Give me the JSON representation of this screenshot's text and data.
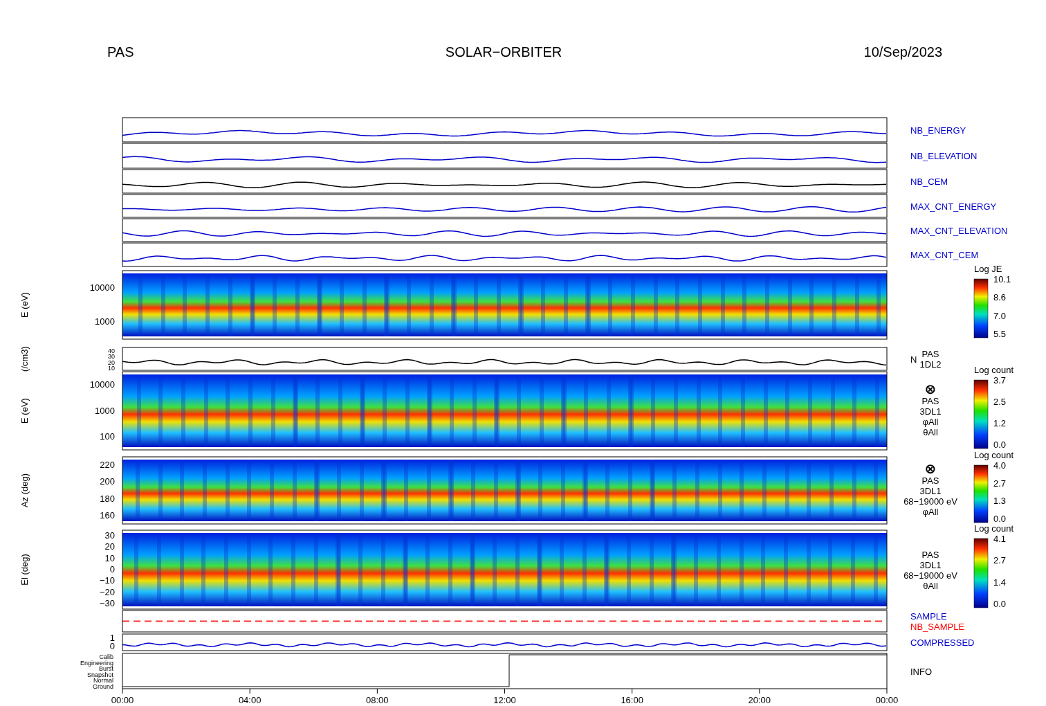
{
  "header": {
    "instrument": "PAS",
    "mission": "SOLAR−ORBITER",
    "date": "10/Sep/2023"
  },
  "panels": [
    {
      "kind": "line",
      "color": "#0000cc",
      "labels": [
        {
          "text": "NB_ENERGY",
          "color": "#0000cc"
        }
      ]
    },
    {
      "kind": "line",
      "color": "#0000cc",
      "labels": [
        {
          "text": "NB_ELEVATION",
          "color": "#0000cc"
        }
      ]
    },
    {
      "kind": "line",
      "color": "#000000",
      "labels": [
        {
          "text": "NB_CEM",
          "color": "#0000cc"
        }
      ]
    },
    {
      "kind": "line",
      "color": "#0000cc",
      "labels": [
        {
          "text": "MAX_CNT_ENERGY",
          "color": "#0000cc"
        }
      ]
    },
    {
      "kind": "line",
      "color": "#0000cc",
      "labels": [
        {
          "text": "MAX_CNT_ELEVATION",
          "color": "#0000cc"
        }
      ]
    },
    {
      "kind": "line",
      "color": "#0000cc",
      "labels": [
        {
          "text": "MAX_CNT_CEM",
          "color": "#0000cc"
        }
      ]
    },
    {
      "kind": "spectrogram",
      "ylabel": "E (eV)",
      "yticks": [
        "10000",
        "1000"
      ],
      "colorbar": {
        "title": "Log JE",
        "ticks": [
          "10.1",
          "8.6",
          "7.0",
          "5.5"
        ]
      }
    },
    {
      "kind": "line",
      "color": "#000000",
      "ylabel": "(/cm3)",
      "yticks": [
        "40",
        "30",
        "20",
        "10"
      ],
      "axis_label": "N",
      "labels": [
        {
          "text": "PAS",
          "color": "#000000"
        },
        {
          "text": "1DL2",
          "color": "#000000"
        }
      ]
    },
    {
      "kind": "spectrogram",
      "ylabel": "E (eV)",
      "yticks": [
        "10000",
        "1000",
        "100"
      ],
      "labels": [
        {
          "text": "⊗",
          "color": "#000000"
        },
        {
          "text": "PAS",
          "color": "#000000"
        },
        {
          "text": "3DL1",
          "color": "#000000"
        },
        {
          "text": "φAll",
          "color": "#000000"
        },
        {
          "text": "θAll",
          "color": "#000000"
        }
      ],
      "colorbar": {
        "title": "Log count",
        "ticks": [
          "3.7",
          "2.5",
          "1.2",
          "0.0"
        ]
      }
    },
    {
      "kind": "spectrogram",
      "ylabel": "Az (deg)",
      "yticks": [
        "220",
        "200",
        "180",
        "160"
      ],
      "labels": [
        {
          "text": "⊗",
          "color": "#000000"
        },
        {
          "text": "PAS",
          "color": "#000000"
        },
        {
          "text": "3DL1",
          "color": "#000000"
        },
        {
          "text": "68−19000 eV",
          "color": "#000000"
        },
        {
          "text": "φAll",
          "color": "#000000"
        }
      ],
      "colorbar": {
        "title": "Log count",
        "ticks": [
          "4.0",
          "2.7",
          "1.3",
          "0.0"
        ]
      }
    },
    {
      "kind": "spectrogram",
      "ylabel": "El (deg)",
      "yticks": [
        "30",
        "20",
        "10",
        "0",
        "−10",
        "−20",
        "−30"
      ],
      "labels": [
        {
          "text": "PAS",
          "color": "#000000"
        },
        {
          "text": "3DL1",
          "color": "#000000"
        },
        {
          "text": "68−19000 eV",
          "color": "#000000"
        },
        {
          "text": "θAll",
          "color": "#000000"
        }
      ],
      "colorbar": {
        "title": "Log count",
        "ticks": [
          "4.1",
          "2.7",
          "1.4",
          "0.0"
        ]
      }
    },
    {
      "kind": "flag",
      "color": "#ff3030",
      "labels": [
        {
          "text": "SAMPLE",
          "color": "#0000cc"
        },
        {
          "text": "NB_SAMPLE",
          "color": "#ff0000"
        }
      ]
    },
    {
      "kind": "line",
      "color": "#0000cc",
      "yticks": [
        "1",
        "0"
      ],
      "labels": [
        {
          "text": "COMPRESSED",
          "color": "#0000cc"
        }
      ]
    },
    {
      "kind": "info",
      "yticks": [
        "Calib",
        "Engineering",
        "Burst",
        "Snapshot",
        "Normal",
        "Ground"
      ],
      "labels": [
        {
          "text": "INFO",
          "color": "#000000"
        }
      ]
    }
  ],
  "xticks": [
    "00:00",
    "04:00",
    "08:00",
    "12:00",
    "16:00",
    "20:00",
    "00:00"
  ]
}
